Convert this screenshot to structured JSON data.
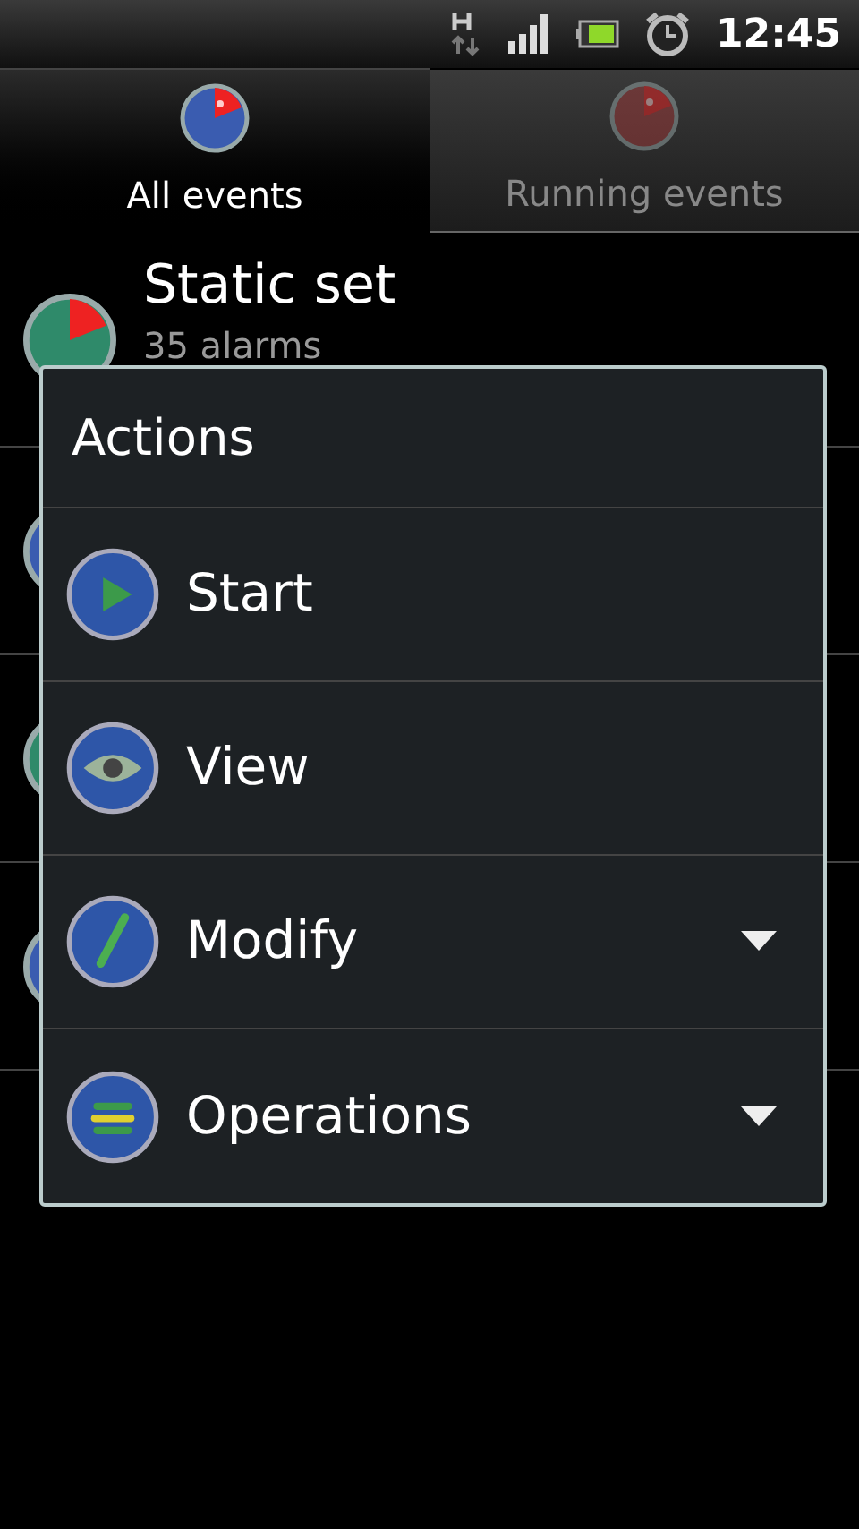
{
  "status_bar": {
    "time": "12:45"
  },
  "tabs": [
    {
      "label": "All events",
      "selected": true
    },
    {
      "label": "Running events",
      "selected": false
    }
  ],
  "events": [
    {
      "title": "Static set",
      "subtitle": "35 alarms",
      "color": "#2f8a6a"
    },
    {
      "color": "#3a5cb0"
    },
    {
      "color": "#2f8a6a"
    },
    {
      "color": "#3a5cb0"
    }
  ],
  "dialog": {
    "title": "Actions",
    "items": [
      {
        "label": "Start",
        "kind": "play",
        "has_submenu": false
      },
      {
        "label": "View",
        "kind": "eye",
        "has_submenu": false
      },
      {
        "label": "Modify",
        "kind": "pencil",
        "has_submenu": true
      },
      {
        "label": "Operations",
        "kind": "lines",
        "has_submenu": true
      }
    ]
  }
}
